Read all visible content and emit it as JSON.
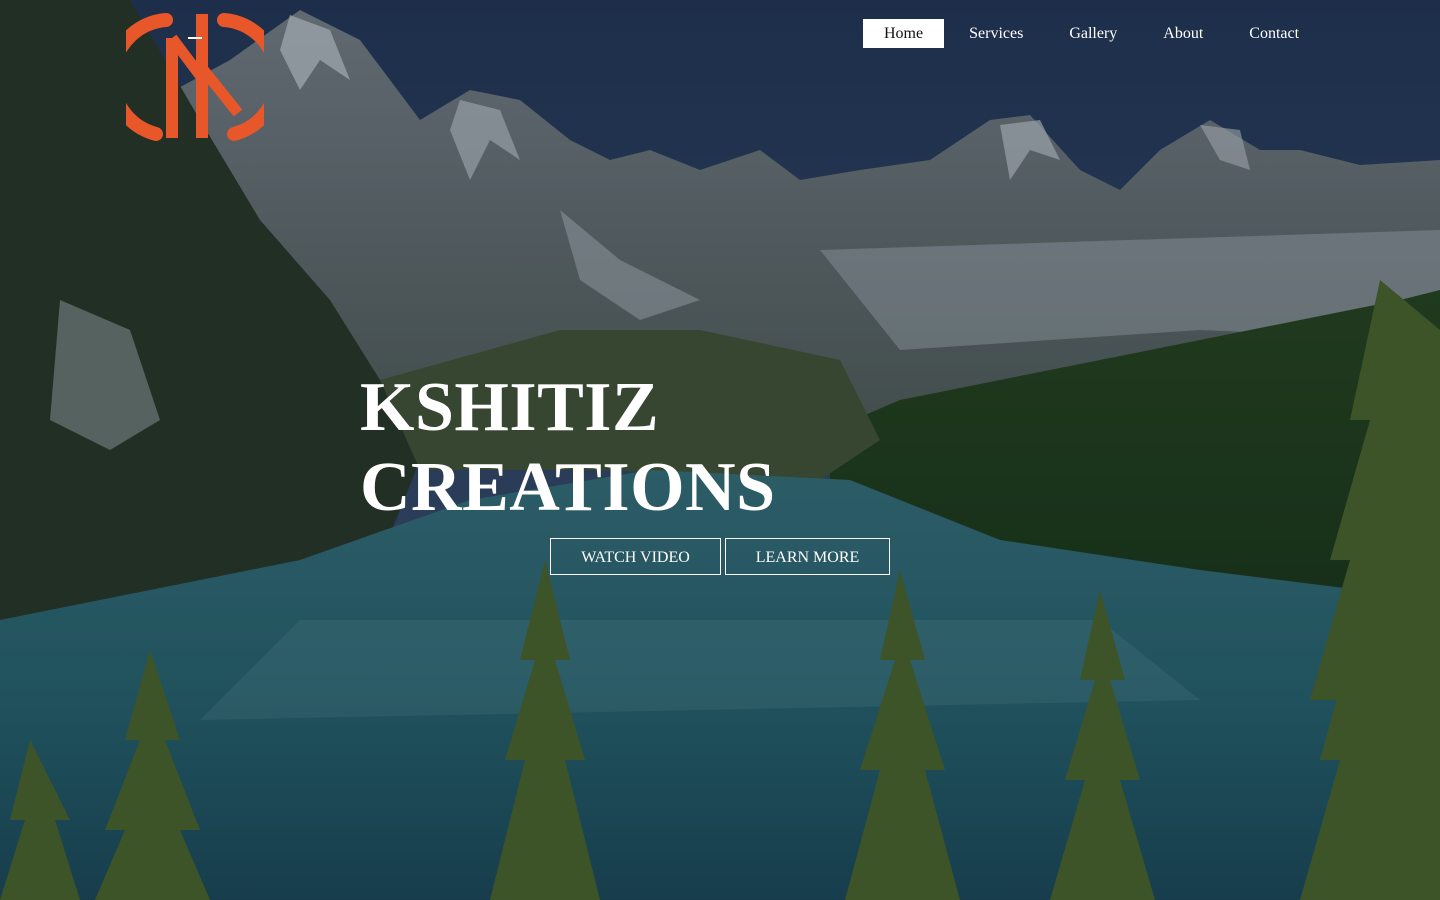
{
  "brand": {
    "logo_icon": "kc-monogram-logo",
    "logo_color": "#e8572a"
  },
  "nav": {
    "items": [
      {
        "label": "Home",
        "active": true
      },
      {
        "label": "Services",
        "active": false
      },
      {
        "label": "Gallery",
        "active": false
      },
      {
        "label": "About",
        "active": false
      },
      {
        "label": "Contact",
        "active": false
      }
    ]
  },
  "hero": {
    "title_line1": "KSHITIZ",
    "title_line2": "CREATIONS",
    "background": "mountain-lake-forest-photo",
    "watch_video_label": "WATCH VIDEO",
    "learn_more_label": "LEARN MORE"
  },
  "colors": {
    "text": "#ffffff",
    "active_nav_bg": "#ffffff",
    "active_nav_text": "#111111",
    "overlay": "#0a1a24"
  }
}
